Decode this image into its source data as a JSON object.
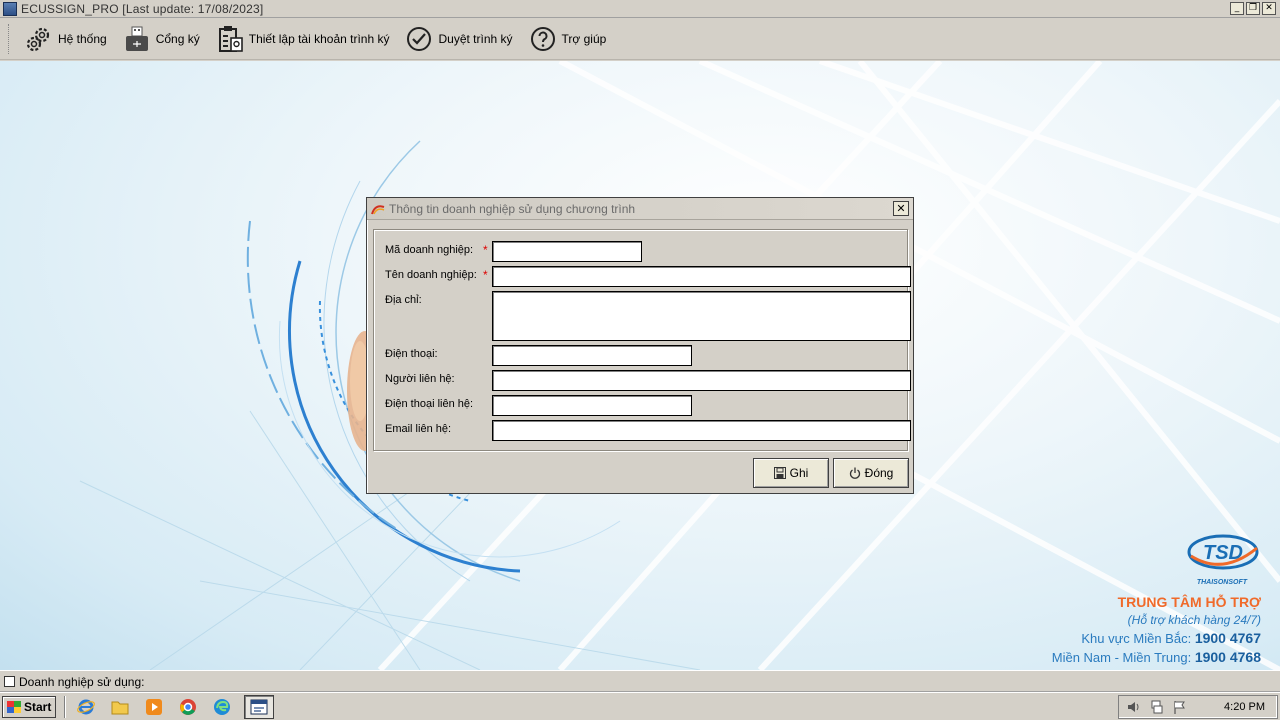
{
  "window": {
    "title": "ECUSSIGN_PRO [Last update: 17/08/2023]"
  },
  "toolbar": {
    "items": [
      {
        "label": "Hệ thống",
        "icon": "gears-icon"
      },
      {
        "label": "Cổng ký",
        "icon": "usb-token-icon"
      },
      {
        "label": "Thiết lập tài khoản trình ký",
        "icon": "account-setup-icon"
      },
      {
        "label": "Duyệt trình ký",
        "icon": "check-circle-icon"
      },
      {
        "label": "Trợ giúp",
        "icon": "help-icon"
      }
    ]
  },
  "dialog": {
    "title": "Thông tin doanh nghiệp sử dụng chương trình",
    "fields": [
      {
        "label": "Mã doanh nghiệp:",
        "required": true,
        "value": ""
      },
      {
        "label": "Tên doanh nghiệp:",
        "required": true,
        "value": ""
      },
      {
        "label": "Địa chỉ:",
        "required": false,
        "value": ""
      },
      {
        "label": "Điện thoại:",
        "required": false,
        "value": ""
      },
      {
        "label": "Người liên hệ:",
        "required": false,
        "value": ""
      },
      {
        "label": "Điện thoại liên hệ:",
        "required": false,
        "value": ""
      },
      {
        "label": "Email liên hệ:",
        "required": false,
        "value": ""
      }
    ],
    "required_mark": "*",
    "save_label": "Ghi",
    "close_label": "Đóng"
  },
  "support": {
    "logo_text": "THAISONSOFT",
    "logo_mark": "TSD",
    "heading": "TRUNG TÂM HỖ TRỢ",
    "subheading": "(Hỗ trợ khách hàng 24/7)",
    "north_label": "Khu vực Miền Bắc:",
    "north_phone": "1900 4767",
    "south_label": "Miền Nam - Miền Trung:",
    "south_phone": "1900 4768"
  },
  "statusbar": {
    "text": "Doanh nghiệp sử dụng:"
  },
  "taskbar": {
    "start_label": "Start",
    "clock": "4:20 PM"
  },
  "colors": {
    "support_heading": "#f06a2a",
    "support_text": "#2a7bbf",
    "required": "#dd0000"
  }
}
